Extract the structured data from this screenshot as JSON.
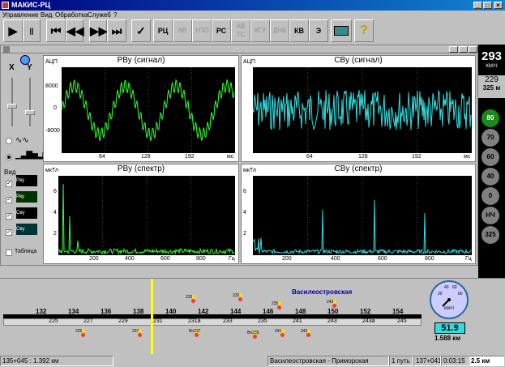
{
  "window": {
    "title": "МАКИС-РЦ",
    "min": "_",
    "max": "□",
    "close": "×"
  },
  "menu": [
    "Управление",
    "Вид",
    "Обработка",
    "Служеб",
    "?"
  ],
  "toolbar": {
    "play": "▶",
    "pause": "||",
    "rewind_start": "⏮",
    "rewind": "◀◀",
    "forward": "▶▶",
    "forward_end": "⏭",
    "check": "✓",
    "rc": "РЦ",
    "av": "АВ",
    "upo": "УПО",
    "rs": "РС",
    "avts": "АВ ТС",
    "kgu": "КГУ",
    "dnb": "ДНБ",
    "kv": "КВ",
    "e": "Э",
    "help": "?"
  },
  "left_panel": {
    "x_label": "X",
    "y_label": "Y",
    "view_label": "Вид",
    "channels": [
      "Рву",
      "Рву",
      "Свy",
      "Свy"
    ],
    "table_label": "Таблица"
  },
  "plots": {
    "top_left": {
      "title": "РВу (сигнал)",
      "ylabel": "АЦП",
      "yticks": [
        "8000",
        "0",
        "-8000"
      ],
      "xticks": [
        "64",
        "128",
        "192"
      ],
      "xunit": "мс"
    },
    "top_right": {
      "title": "СВу (сигнал)",
      "ylabel": "АЦП",
      "xticks": [
        "64",
        "128",
        "192"
      ],
      "xunit": "мс"
    },
    "bottom_left": {
      "title": "РВу (спектр)",
      "ylabel": "мкТл",
      "yticks": [
        "6",
        "4",
        "2"
      ],
      "xticks": [
        "200",
        "400",
        "600",
        "800"
      ],
      "xunit": "Гц"
    },
    "bottom_right": {
      "title": "СВу (спектр)",
      "ylabel": "мкТл",
      "yticks": [
        "6",
        "4",
        "2"
      ],
      "xticks": [
        "200",
        "400",
        "600",
        "800"
      ],
      "xunit": "Гц"
    }
  },
  "speed": {
    "value": "293",
    "unit": "КМ/Ч",
    "sub": "229",
    "dist": "325 м",
    "limits": [
      "80",
      "70",
      "60",
      "40",
      "0",
      "НЧ",
      "325"
    ]
  },
  "track": {
    "station": "Василеостровская",
    "upper_nums": [
      "132",
      "134",
      "136",
      "138",
      "140",
      "142",
      "144",
      "146",
      "148",
      "150",
      "152",
      "154"
    ],
    "lower_nums": [
      "225",
      "227",
      "229",
      "231",
      "231а",
      "233",
      "235",
      "241",
      "243",
      "243а",
      "245"
    ],
    "signal_labels": [
      "233",
      "233",
      "235",
      "225",
      "237",
      "Bn237",
      "Bn235",
      "241",
      "243",
      "243"
    ],
    "gauge_value": "51.9",
    "gauge_dist": "1.588 км",
    "gauge_ticks": [
      "20",
      "40",
      "60",
      "80"
    ],
    "gauge_unit": "КМ/Ч"
  },
  "status": {
    "coords": "135+045 : 1.392 км",
    "section": "Василеостровская - Приморская",
    "path": "1 путь",
    "pos": "137+041",
    "time": "0:03:15",
    "scale": "2.5 км"
  },
  "colors": {
    "signal": "#33ff33",
    "cyan": "#33dddd",
    "titlebar": "#000080",
    "cursor": "#ffff00"
  }
}
